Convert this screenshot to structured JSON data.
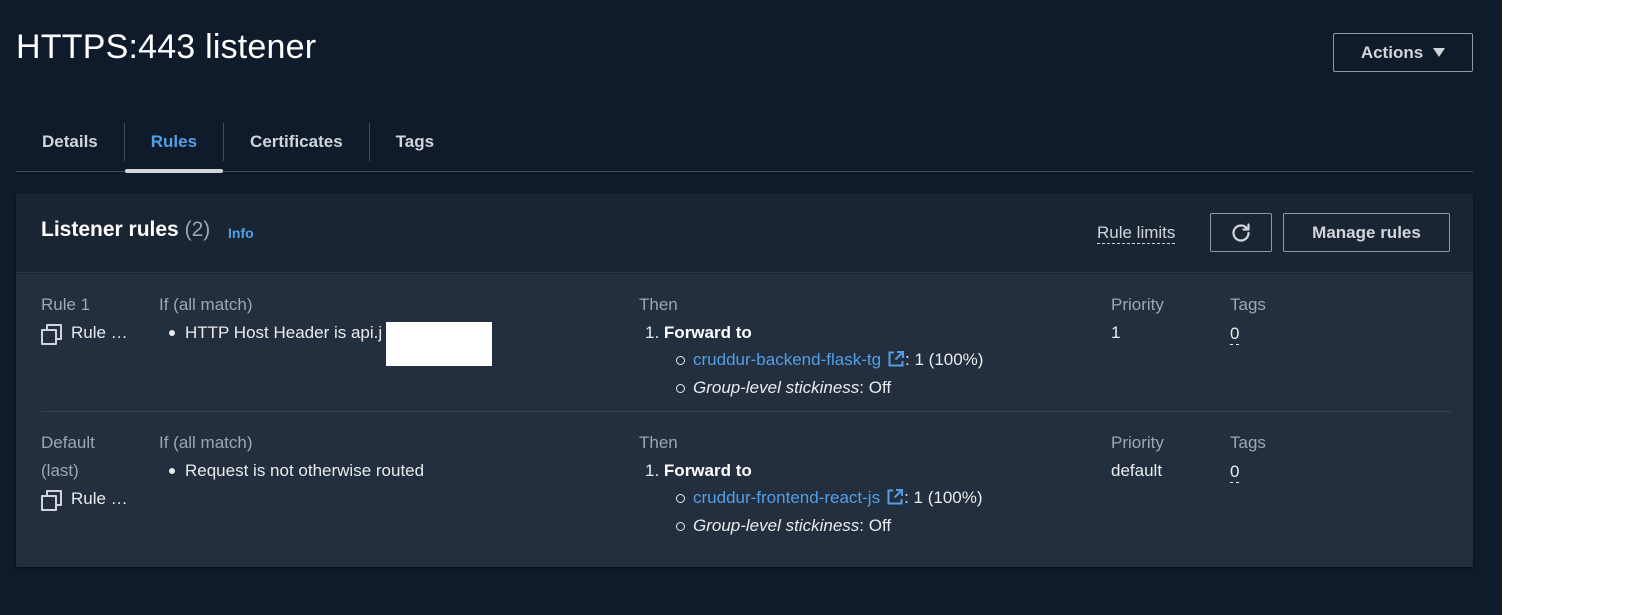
{
  "header": {
    "title": "HTTPS:443 listener",
    "actions_label": "Actions"
  },
  "tabs": [
    {
      "label": "Details"
    },
    {
      "label": "Rules"
    },
    {
      "label": "Certificates"
    },
    {
      "label": "Tags"
    }
  ],
  "panel": {
    "title": "Listener rules",
    "count": "(2)",
    "info": "Info",
    "rule_limits": "Rule limits",
    "manage_rules": "Manage rules"
  },
  "columns": {
    "if": "If (all match)",
    "then": "Then",
    "priority": "Priority",
    "tags": "Tags"
  },
  "rules": [
    {
      "label": "Rule 1",
      "name": "Rule …",
      "condition": "HTTP Host Header is api.j          .uk",
      "step": "1.",
      "action": "Forward to",
      "target_group": "cruddur-backend-flask-tg",
      "weight": ": 1 (100%)",
      "stickiness_label": "Group-level stickiness",
      "stickiness_value": ": Off",
      "priority": "1",
      "tags": "0"
    },
    {
      "label": "Default",
      "label2": "(last)",
      "name": "Rule …",
      "condition": "Request is not otherwise routed",
      "step": "1.",
      "action": "Forward to",
      "target_group": "cruddur-frontend-react-js",
      "weight": ": 1 (100%)",
      "stickiness_label": "Group-level stickiness",
      "stickiness_value": ": Off",
      "priority": "default",
      "tags": "0"
    }
  ],
  "icons": {
    "refresh": "refresh-icon",
    "copy": "copy-icon",
    "external": "external-link-icon",
    "caret": "caret-down-icon"
  },
  "colors": {
    "background": "#0f1b2a",
    "panel": "#232f3e",
    "link": "#539fe5",
    "text": "#e9ebed"
  }
}
